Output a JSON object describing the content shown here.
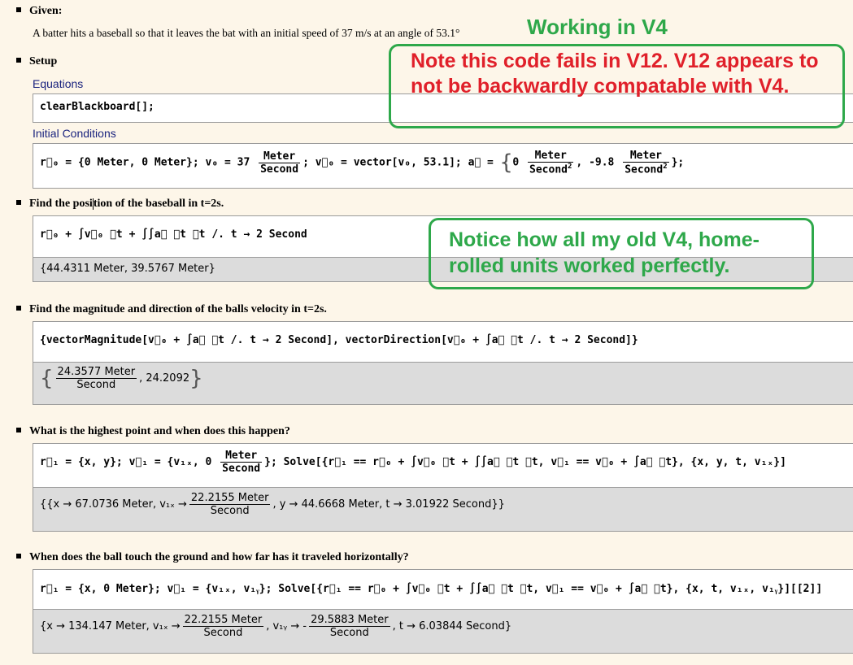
{
  "given": {
    "heading": "Given:",
    "text": "A batter hits a baseball so that it leaves the bat with an initial speed of 37 m/s at an angle of 53.1°"
  },
  "setup": {
    "heading": "Setup",
    "equations_label": "Equations",
    "initial_label": "Initial Conditions",
    "code1": "clearBlackboard[];"
  },
  "ic": {
    "r0": "r⃗₀ = {0 Meter, 0 Meter}; v₀ = 37",
    "meter": "Meter",
    "second": "Second",
    "v0": "; v⃗₀ = vector[v₀, 53.1]; a⃗ = ",
    "a_open": "0",
    "a_mid": ", -9.8",
    "a_end": "};"
  },
  "s1": {
    "heading_a": "Find the posi",
    "heading_b": "tion of the baseball in t=2s.",
    "input": "r⃗₀ + ∫v⃗₀ ⅆt + ∫∫a⃗ ⅆt ⅆt /. t → 2 Second",
    "output": "{44.4311 Meter, 39.5767 Meter}"
  },
  "s2": {
    "heading": "Find the magnitude and direction of the balls velocity in t=2s.",
    "input": "{vectorMagnitude[v⃗₀ + ∫a⃗ ⅆt /. t → 2 Second], vectorDirection[v⃗₀ + ∫a⃗ ⅆt /. t → 2 Second]}",
    "out_num": "24.3577 Meter",
    "out_den": "Second",
    "out_rest": ", 24.2092"
  },
  "s3": {
    "heading": "What is the highest point and when does this happen?",
    "input_a": "r⃗₁ = {x, y}; v⃗₁ = {v₁ₓ, 0",
    "input_b": "}; Solve[{r⃗₁ == r⃗₀ + ∫v⃗₀ ⅆt + ∫∫a⃗ ⅆt ⅆt, v⃗₁ == v⃗₀ + ∫a⃗ ⅆt}, {x, y, t, v₁ₓ}]",
    "out_a": "{{x → 67.0736 Meter, v₁ₓ →",
    "out_num": "22.2155 Meter",
    "out_den": "Second",
    "out_b": ", y → 44.6668 Meter, t → 3.01922 Second}}"
  },
  "s4": {
    "heading": "When does the ball touch the ground and how far has it traveled horizontally?",
    "input": "r⃗₁ = {x, 0 Meter}; v⃗₁ = {v₁ₓ, v₁ᵧ}; Solve[{r⃗₁ == r⃗₀ + ∫v⃗₀ ⅆt + ∫∫a⃗ ⅆt ⅆt, v⃗₁ == v⃗₀ + ∫a⃗ ⅆt}, {x, t, v₁ₓ, v₁ᵧ}][[2]]",
    "out_a": "{x → 134.147 Meter, v₁ₓ →",
    "num1": "22.2155 Meter",
    "den1": "Second",
    "out_b": ", v₁ᵧ → -",
    "num2": "29.5883 Meter",
    "den2": "Second",
    "out_c": ", t → 6.03844 Second}"
  },
  "notes": {
    "working": "Working in V4",
    "fails": "Note this code fails in V12. V12 appears to not be backwardly compatable with V4.",
    "notice": "Notice how all my old V4, home-rolled units worked perfectly."
  },
  "colors": {
    "green": "#2ea84a",
    "red": "#e0202a",
    "link": "#1a237e"
  }
}
